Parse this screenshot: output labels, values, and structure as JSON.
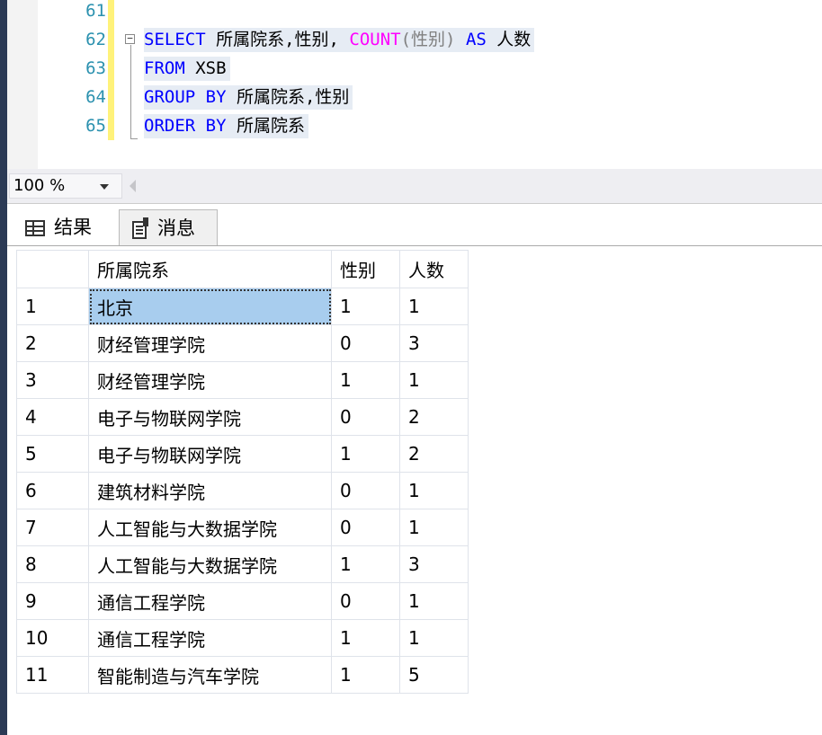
{
  "editor": {
    "lines": [
      {
        "number": "61"
      },
      {
        "number": "62",
        "tokens": {
          "select": "SELECT",
          "cols": " 所属院系,性别, ",
          "count": "COUNT",
          "count_args": "(性别) ",
          "as": "AS",
          "alias": " 人数"
        }
      },
      {
        "number": "63",
        "tokens": {
          "from": "FROM",
          "table": " XSB"
        }
      },
      {
        "number": "64",
        "tokens": {
          "group_by": "GROUP BY",
          "cols": " 所属院系,性别"
        }
      },
      {
        "number": "65",
        "tokens": {
          "order_by": "ORDER BY",
          "cols": " 所属院系"
        }
      }
    ],
    "fold_icon": "minus-box-icon"
  },
  "zoom": {
    "value": "100 %"
  },
  "tabs": [
    {
      "label": "结果",
      "icon": "grid-icon"
    },
    {
      "label": "消息",
      "icon": "messages-icon"
    }
  ],
  "results": {
    "columns": [
      "",
      "所属院系",
      "性别",
      "人数"
    ],
    "rows": [
      [
        "1",
        "北京",
        "1",
        "1"
      ],
      [
        "2",
        "财经管理学院",
        "0",
        "3"
      ],
      [
        "3",
        "财经管理学院",
        "1",
        "1"
      ],
      [
        "4",
        "电子与物联网学院",
        "0",
        "2"
      ],
      [
        "5",
        "电子与物联网学院",
        "1",
        "2"
      ],
      [
        "6",
        "建筑材料学院",
        "0",
        "1"
      ],
      [
        "7",
        "人工智能与大数据学院",
        "0",
        "1"
      ],
      [
        "8",
        "人工智能与大数据学院",
        "1",
        "3"
      ],
      [
        "9",
        "通信工程学院",
        "0",
        "1"
      ],
      [
        "10",
        "通信工程学院",
        "1",
        "1"
      ],
      [
        "11",
        "智能制造与汽车学院",
        "1",
        "5"
      ]
    ]
  },
  "colors": {
    "selected_cell": "#a8cdee",
    "keyword": "#0000ff",
    "function": "#ff00ff",
    "line_number": "#2b91af",
    "change_bar": "#fff27a"
  }
}
